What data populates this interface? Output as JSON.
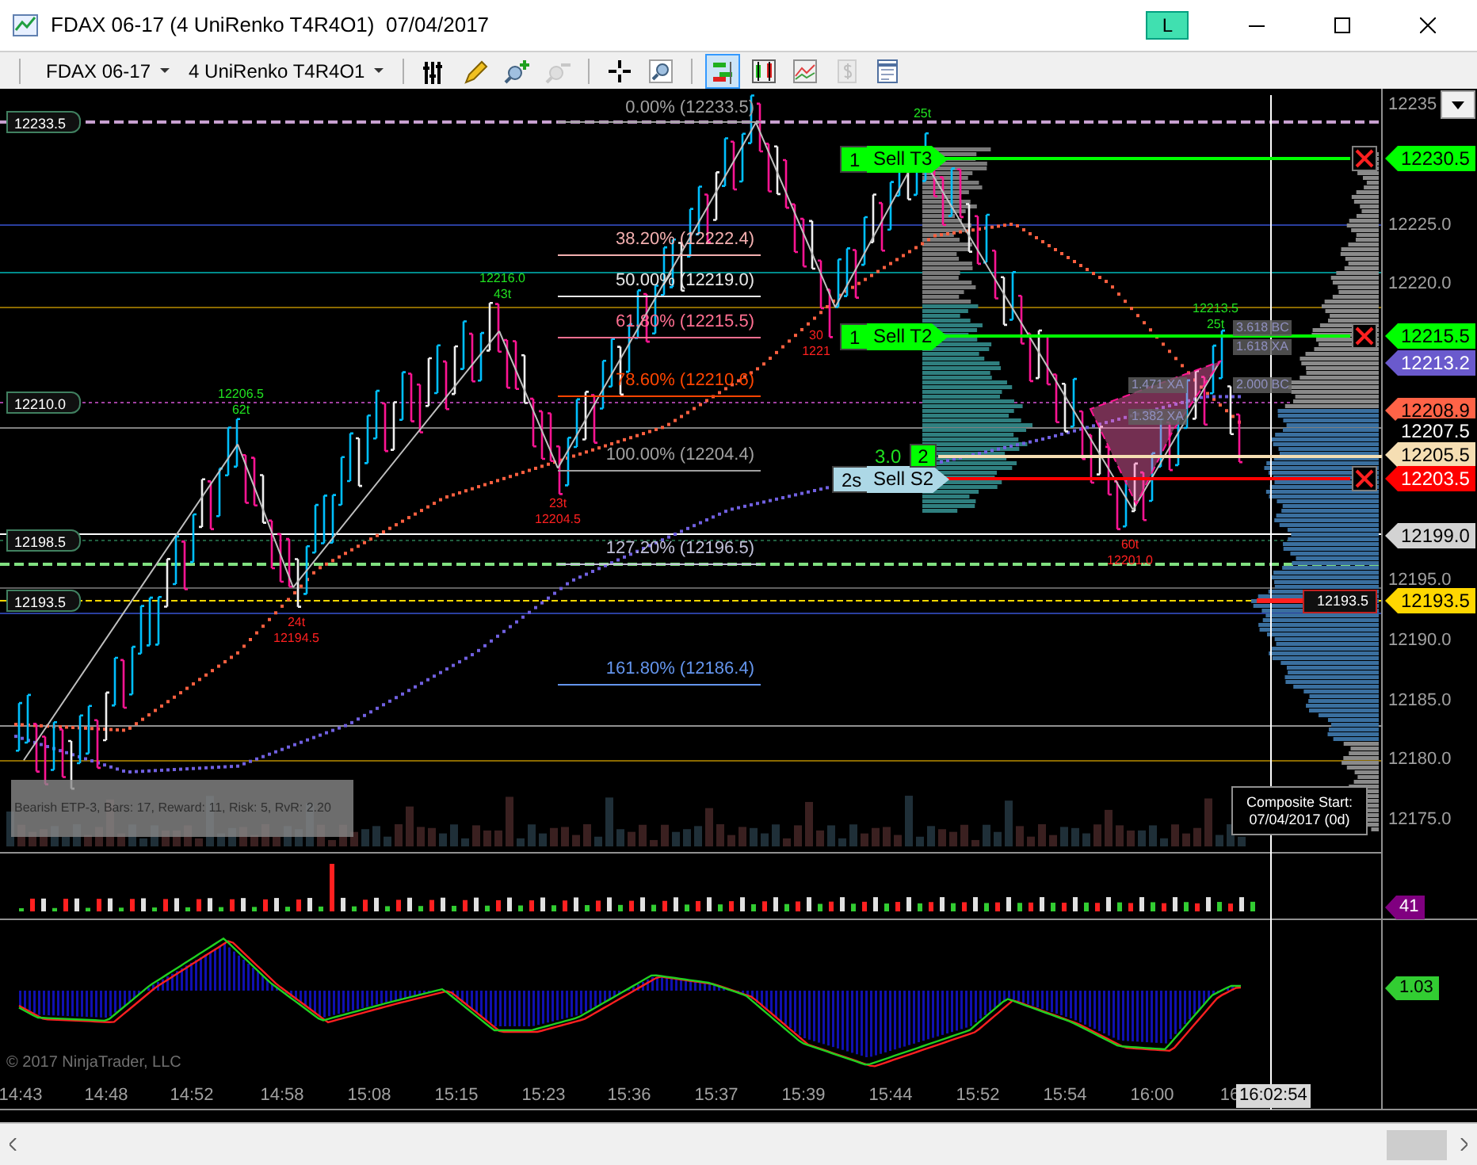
{
  "window": {
    "title": "FDAX 06-17 (4 UniRenko T4R4O1)  07/04/2017",
    "badge": "L"
  },
  "toolbar": {
    "instrument": "FDAX 06-17",
    "bar_type": "4 UniRenko T4R4O1",
    "tools": [
      {
        "kind": "bars",
        "selected": false,
        "disabled": false
      },
      {
        "kind": "pencil",
        "selected": false,
        "disabled": false
      },
      {
        "kind": "zoom_in",
        "selected": false,
        "disabled": false
      },
      {
        "kind": "zoom_out",
        "selected": false,
        "disabled": true
      },
      {
        "kind": "crosshair",
        "selected": false,
        "disabled": false
      },
      {
        "kind": "magnifier",
        "selected": false,
        "disabled": false
      },
      {
        "kind": "chart_trader",
        "selected": true,
        "disabled": false
      },
      {
        "kind": "candles",
        "selected": false,
        "disabled": false
      },
      {
        "kind": "indicators",
        "selected": false,
        "disabled": false
      },
      {
        "kind": "money",
        "selected": false,
        "disabled": true
      },
      {
        "kind": "properties",
        "selected": false,
        "disabled": false
      }
    ]
  },
  "price_axis": {
    "labels": [
      "12235",
      "12225.0",
      "12220.0",
      "12195.0",
      "12190.0",
      "12185.0",
      "12180.0",
      "12175.0"
    ]
  },
  "price_flags": [
    {
      "text": "12230.5",
      "color": "#00ff00"
    },
    {
      "text": "12215.5",
      "color": "#00ff00"
    },
    {
      "text": "12213.2",
      "color": "#6a5acd"
    },
    {
      "text": "12208.9",
      "color": "#ff6347"
    },
    {
      "text": "12207.5",
      "color": "#000000"
    },
    {
      "text": "12205.5",
      "color": "#f5deb3"
    },
    {
      "text": "12203.5",
      "color": "#ff0000"
    },
    {
      "text": "12199.0",
      "color": "#d3d3d3"
    },
    {
      "text": "12193.5",
      "color": "#ffd700"
    }
  ],
  "left_flags": [
    "12233.5",
    "12210.0",
    "12198.5",
    "12193.5"
  ],
  "fib_levels": [
    {
      "text": "0.00% (12233.5)",
      "color": "#a0a0a0"
    },
    {
      "text": "38.20% (12222.4)",
      "color": "#f4b0b0"
    },
    {
      "text": "50.00% (12219.0)",
      "color": "#e8e8e8"
    },
    {
      "text": "61.80% (12215.5)",
      "color": "#ff6f91"
    },
    {
      "text": "78.60% (12210.6)",
      "color": "#ff4500"
    },
    {
      "text": "100.00% (12204.4)",
      "color": "#a0a0a0"
    },
    {
      "text": "127.20% (12196.5)",
      "color": "#c0c0d8"
    },
    {
      "text": "161.80% (12186.4)",
      "color": "#6495ed"
    }
  ],
  "swing_labels": [
    {
      "kind": "high",
      "lines": [
        "12206.5",
        "62t"
      ]
    },
    {
      "kind": "high",
      "lines": [
        "12216.0",
        "43t"
      ]
    },
    {
      "kind": "low",
      "lines": [
        "23t",
        "12204.5"
      ]
    },
    {
      "kind": "low",
      "lines": [
        "24t",
        "12194.5"
      ]
    },
    {
      "kind": "high",
      "lines": [
        "25t"
      ]
    },
    {
      "kind": "low",
      "lines": [
        "30",
        "1221"
      ]
    },
    {
      "kind": "high",
      "lines": [
        "12213.5",
        "25t"
      ]
    },
    {
      "kind": "low",
      "lines": [
        "60t",
        "12201.0"
      ]
    }
  ],
  "orders": [
    {
      "qty": "1",
      "label": "Sell T3",
      "kind": "target"
    },
    {
      "qty": "1",
      "label": "Sell T2",
      "kind": "target"
    },
    {
      "qty": "2s",
      "label": "Sell S2",
      "kind": "stop"
    }
  ],
  "entry": {
    "price": "3.0",
    "qty": "2"
  },
  "pattern_labels": [
    "3.618 BC",
    "1.618 XA",
    "1.471 XA",
    "2.000 BC",
    "1.382 XA"
  ],
  "info_box": "Bearish ETP-3, Bars: 17, Reward: 11, Risk: 5, RvR: 2.20",
  "composite": [
    "Composite Start:",
    "07/04/2017 (0d)"
  ],
  "profile_label": "12193.5",
  "panel_flags": [
    {
      "text": "41",
      "color": "#800080"
    },
    {
      "text": "1.03",
      "color": "#32cd32"
    }
  ],
  "copyright": "© 2017 NinjaTrader, LLC",
  "time_axis": {
    "labels": [
      "14:43",
      "14:48",
      "14:52",
      "14:58",
      "15:08",
      "15:15",
      "15:23",
      "15:36",
      "15:37",
      "15:39",
      "15:44",
      "15:52",
      "15:54",
      "16:00",
      "16"
    ],
    "crosshair_time": "16:02:54"
  }
}
